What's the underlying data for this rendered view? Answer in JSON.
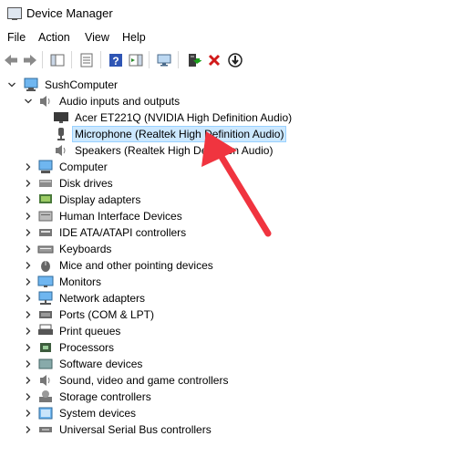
{
  "window": {
    "title": "Device Manager"
  },
  "menu": [
    "File",
    "Action",
    "View",
    "Help"
  ],
  "toolbar": [
    "back-icon",
    "forward-icon",
    "show-hide-console-tree-icon",
    "properties-icon",
    "help-icon",
    "action-pane-icon",
    "scan-hardware-changes-icon",
    "update-driver-icon",
    "uninstall-device-icon",
    "disable-device-icon"
  ],
  "tree": {
    "root": "SushComputer",
    "audio_group": "Audio inputs and outputs",
    "audio_children": [
      "Acer ET221Q (NVIDIA High Definition Audio)",
      "Microphone (Realtek High Definition Audio)",
      "Speakers (Realtek High Definition Audio)"
    ],
    "categories": [
      "Computer",
      "Disk drives",
      "Display adapters",
      "Human Interface Devices",
      "IDE ATA/ATAPI controllers",
      "Keyboards",
      "Mice and other pointing devices",
      "Monitors",
      "Network adapters",
      "Ports (COM & LPT)",
      "Print queues",
      "Processors",
      "Software devices",
      "Sound, video and game controllers",
      "Storage controllers",
      "System devices",
      "Universal Serial Bus controllers"
    ]
  },
  "colors": {
    "selection": "#cce8ff",
    "arrow": "#f0343f"
  }
}
